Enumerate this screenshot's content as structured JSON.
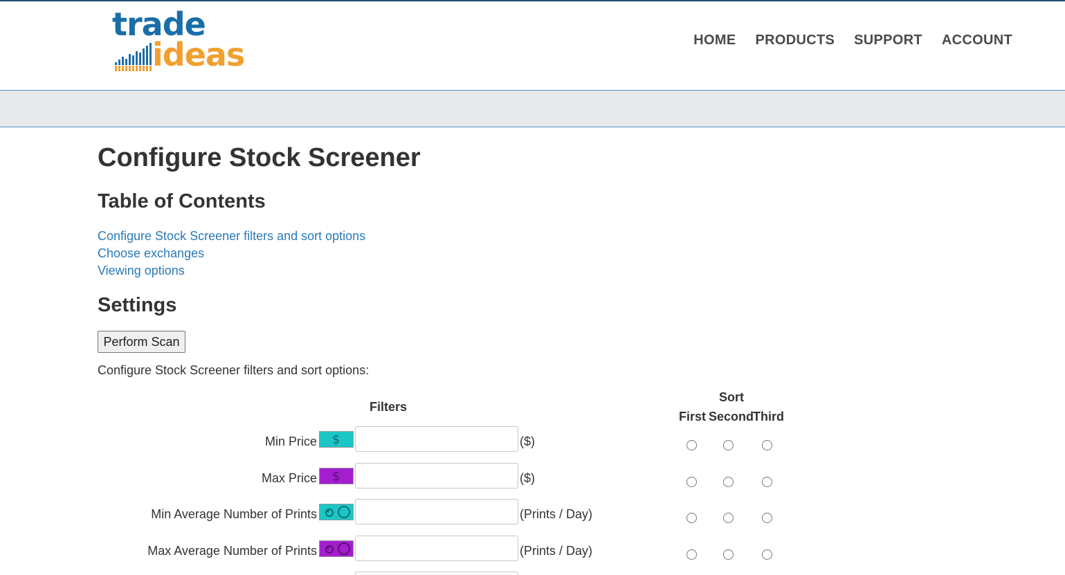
{
  "brand": {
    "logo_top": "trade",
    "logo_bottom": "ideas"
  },
  "nav": {
    "items": [
      "HOME",
      "PRODUCTS",
      "SUPPORT",
      "ACCOUNT"
    ]
  },
  "page": {
    "title": "Configure Stock Screener",
    "toc_heading": "Table of Contents",
    "toc_links": [
      "Configure Stock Screener filters and sort options",
      "Choose exchanges",
      "Viewing options"
    ],
    "settings_heading": "Settings",
    "scan_button": "Perform Scan",
    "intro_text": "Configure Stock Screener filters and sort options:"
  },
  "table": {
    "filters_header": "Filters",
    "sort_header": "Sort",
    "sort_columns": [
      "First",
      "Second",
      "Third"
    ],
    "rows": [
      {
        "label": "Min Price",
        "unit": "($)",
        "value": "",
        "icon": "dollar-icon",
        "color": "#1cc6c6"
      },
      {
        "label": "Max Price",
        "unit": "($)",
        "value": "",
        "icon": "dollar-icon",
        "color": "#a31ecf"
      },
      {
        "label": "Min Average Number of Prints",
        "unit": "(Prints / Day)",
        "value": "",
        "icon": "prints-icon",
        "color": "#1cc6c6"
      },
      {
        "label": "Max Average Number of Prints",
        "unit": "(Prints / Day)",
        "value": "",
        "icon": "prints-icon",
        "color": "#a31ecf"
      }
    ]
  },
  "colors": {
    "link": "#2a7ab8",
    "header_border": "#5b8db8",
    "subbar": "#e8e9eb",
    "logo_blue": "#1a6ea8",
    "logo_orange": "#f0a030"
  }
}
